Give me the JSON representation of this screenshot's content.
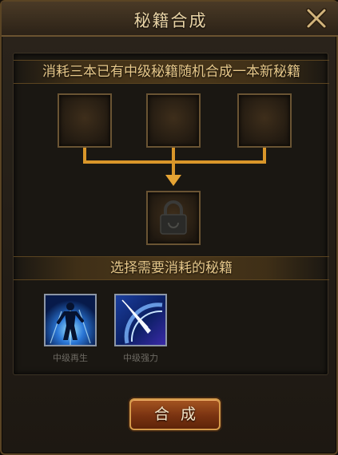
{
  "window": {
    "title": "秘籍合成"
  },
  "panel": {
    "instruction": "消耗三本已有中级秘籍随机合成一本新秘籍",
    "select_heading": "选择需要消耗的秘籍"
  },
  "slots": [
    {
      "state": "empty"
    },
    {
      "state": "empty"
    },
    {
      "state": "empty"
    }
  ],
  "result_slot": {
    "state": "locked",
    "icon": "lock-icon"
  },
  "books": [
    {
      "name": "中级再生",
      "icon": "regeneration-figure-icon"
    },
    {
      "name": "中级强力",
      "icon": "power-strike-icon"
    }
  ],
  "actions": {
    "merge": "合成"
  },
  "colors": {
    "accent_gold": "#d9962a",
    "title_text": "#e9d3a5",
    "banner_text": "#e8c98b",
    "button_red": "#7a3311"
  }
}
